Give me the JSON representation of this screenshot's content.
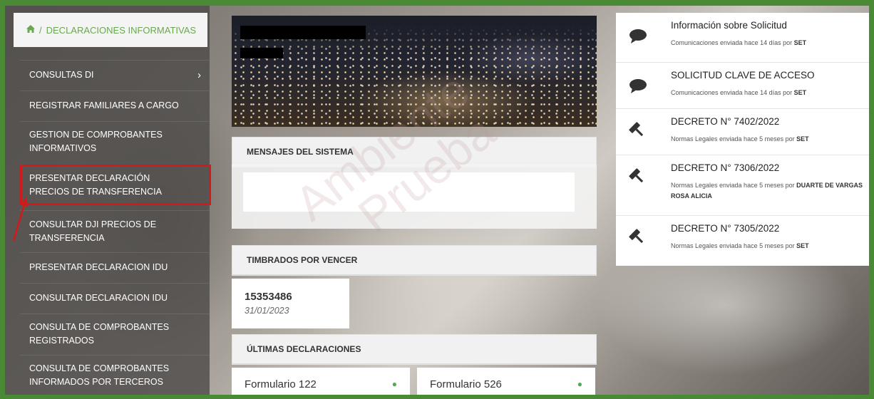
{
  "breadcrumb": {
    "home_icon": "home-icon",
    "separator": "/",
    "label": "DECLARACIONES INFORMATIVAS"
  },
  "sidebar": {
    "items": [
      {
        "label": "CONSULTAS DI",
        "has_submenu": true
      },
      {
        "label": "REGISTRAR FAMILIARES A CARGO"
      },
      {
        "label": "GESTION DE COMPROBANTES INFORMATIVOS"
      },
      {
        "label": "PRESENTAR DECLARACIÓN PRECIOS DE TRANSFERENCIA",
        "highlighted": true
      },
      {
        "label": "CONSULTAR DJI PRECIOS DE TRANSFERENCIA"
      },
      {
        "label": "PRESENTAR DECLARACION IDU"
      },
      {
        "label": "CONSULTAR DECLARACION IDU"
      },
      {
        "label": "CONSULTA DE COMPROBANTES REGISTRADOS"
      },
      {
        "label": "CONSULTA DE COMPROBANTES INFORMADOS POR TERCEROS"
      }
    ]
  },
  "panels": {
    "mensajes_title": "MENSAJES DEL SISTEMA",
    "timbrados_title": "TIMBRADOS POR VENCER",
    "ultimas_title": "ÚLTIMAS DECLARACIONES"
  },
  "timbrado": {
    "number": "15353486",
    "date": "31/01/2023"
  },
  "declaraciones": [
    {
      "label": "Formulario 122"
    },
    {
      "label": "Formulario 526"
    }
  ],
  "watermark": {
    "line1": "Ambiente",
    "line2": "Prueba"
  },
  "notifications": [
    {
      "icon": "comment-icon",
      "title": "Información sobre Solicitud",
      "sub_text": "Comunicaciones enviada hace 14 días por ",
      "sub_author": "SET"
    },
    {
      "icon": "comment-icon",
      "title": "SOLICITUD CLAVE DE ACCESO",
      "sub_text": "Comunicaciones enviada hace 14 días por ",
      "sub_author": "SET"
    },
    {
      "icon": "gavel-icon",
      "title": "DECRETO N° 7402/2022",
      "sub_text": "Normas Legales enviada hace 5 meses por ",
      "sub_author": "SET"
    },
    {
      "icon": "gavel-icon",
      "title": "DECRETO N° 7306/2022",
      "sub_text": "Normas Legales enviada hace 5 meses por ",
      "sub_author": "DUARTE DE VARGAS ROSA ALICIA"
    },
    {
      "icon": "gavel-icon",
      "title": "DECRETO N° 7305/2022",
      "sub_text": "Normas Legales enviada hace 5 meses por ",
      "sub_author": "SET"
    }
  ],
  "colors": {
    "frame_border": "#4a8a36",
    "accent_green": "#6aa84f",
    "highlight_red": "#d11b1b"
  }
}
